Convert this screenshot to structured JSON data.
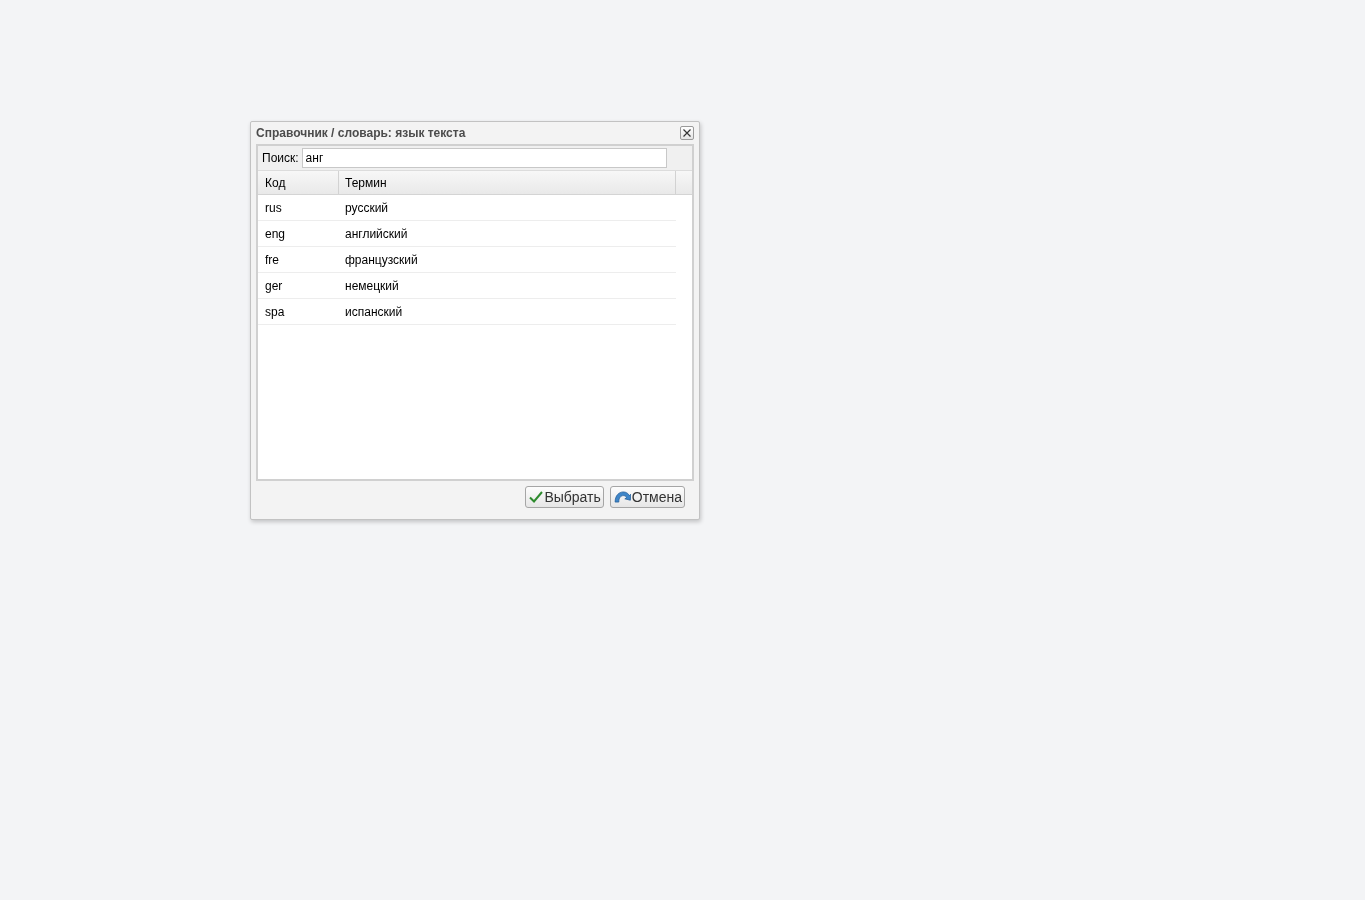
{
  "dialog": {
    "title": "Справочник / словарь: язык текста"
  },
  "search": {
    "label": "Поиск:",
    "value": "анг"
  },
  "table": {
    "columns": [
      "Код",
      "Термин"
    ],
    "rows": [
      {
        "code": "rus",
        "term": "русский",
        "selected": false
      },
      {
        "code": "eng",
        "term": "английский",
        "selected": false
      },
      {
        "code": "fre",
        "term": "французский",
        "selected": false
      },
      {
        "code": "ger",
        "term": "немецкий",
        "selected": false
      },
      {
        "code": "spa",
        "term": "испанский",
        "selected": false
      }
    ]
  },
  "buttons": [
    {
      "label": "Выбрать",
      "kind": "confirm"
    },
    {
      "label": "Отмена",
      "kind": "cancel"
    }
  ]
}
